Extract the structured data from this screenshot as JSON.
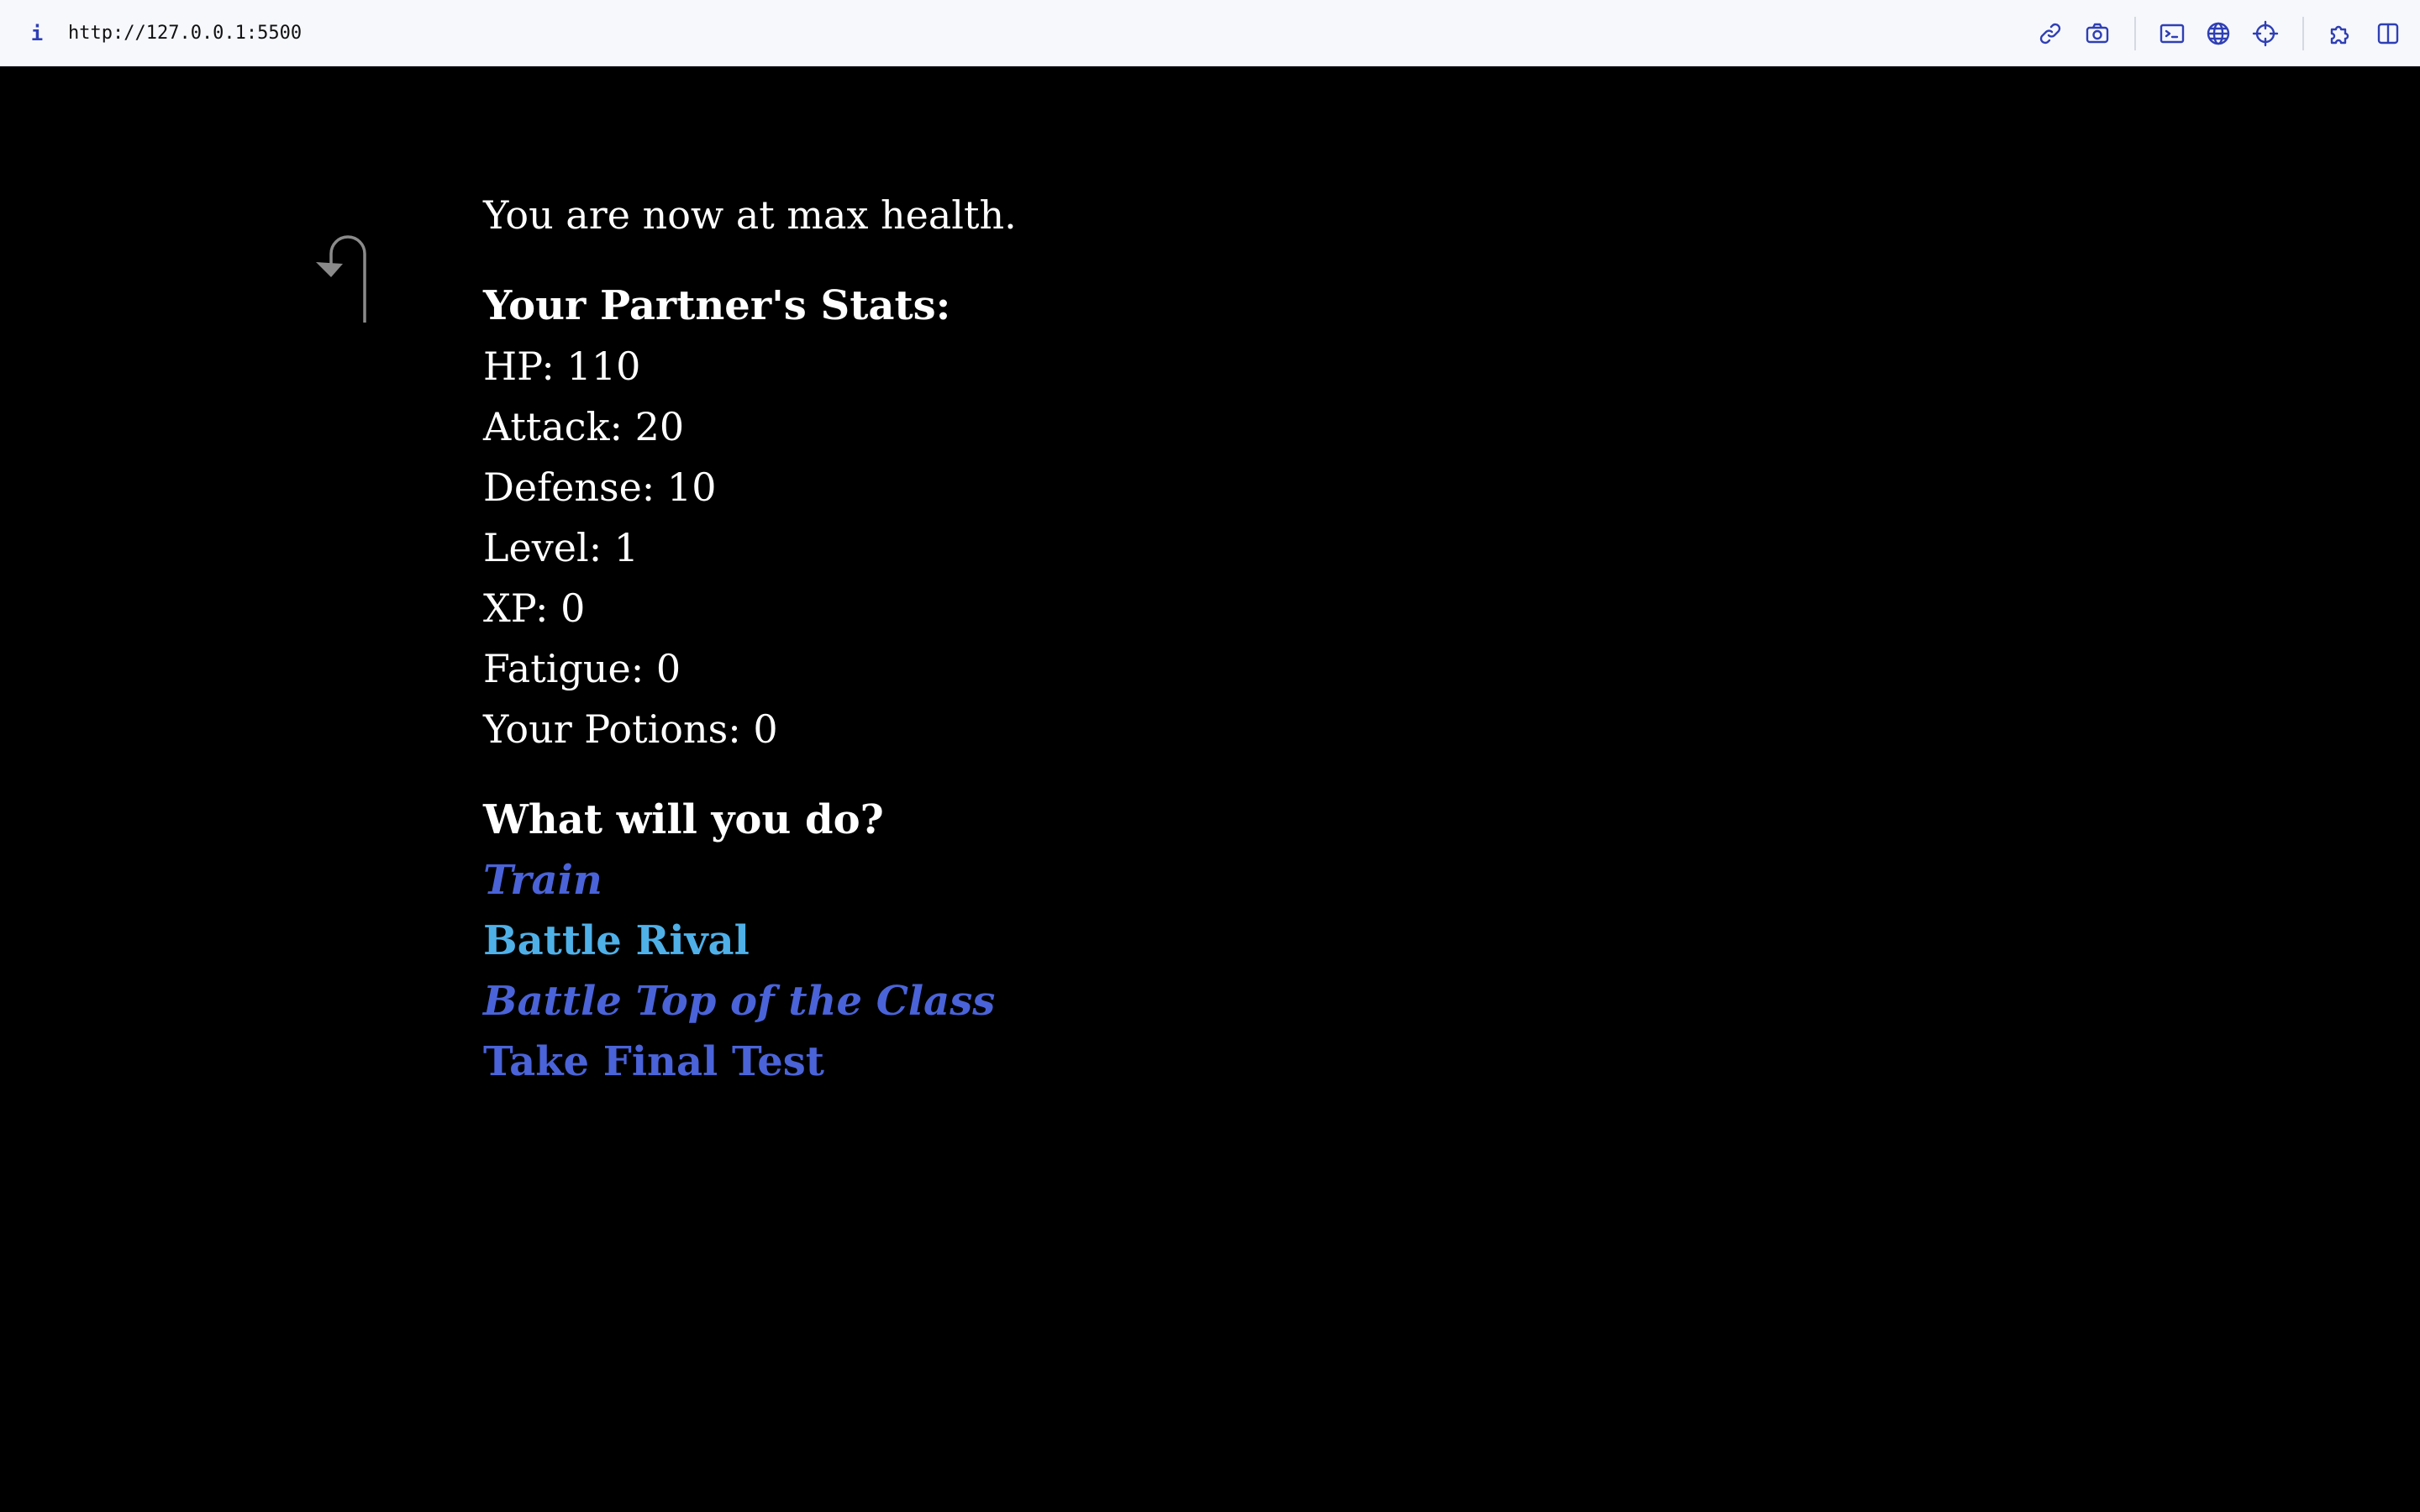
{
  "browser": {
    "info_glyph": "i",
    "url": "http://127.0.0.1:5500",
    "toolbar_icons": [
      "link-icon",
      "camera-icon",
      "terminal-icon",
      "globe-icon",
      "crosshair-icon",
      "extension-icon",
      "split-view-icon"
    ],
    "accent_color": "#2f3fb5"
  },
  "game": {
    "message": "You are now at max health.",
    "stats_heading": "Your Partner's Stats:",
    "stats": [
      "HP: 110",
      "Attack: 20",
      "Defense: 10",
      "Level: 1",
      "XP: 0",
      "Fatigue: 0",
      "Your Potions: 0"
    ],
    "prompt": "What will you do?",
    "actions": [
      {
        "label": "Train",
        "style": "italic",
        "color": "#4a63d8"
      },
      {
        "label": "Battle Rival",
        "style": "normal",
        "color": "#4fb0e8"
      },
      {
        "label": "Battle Top of the Class",
        "style": "italic",
        "color": "#4a63d8"
      },
      {
        "label": "Take Final Test",
        "style": "normal",
        "color": "#4a63d8"
      }
    ],
    "undo_icon": "undo-arrow-icon"
  }
}
